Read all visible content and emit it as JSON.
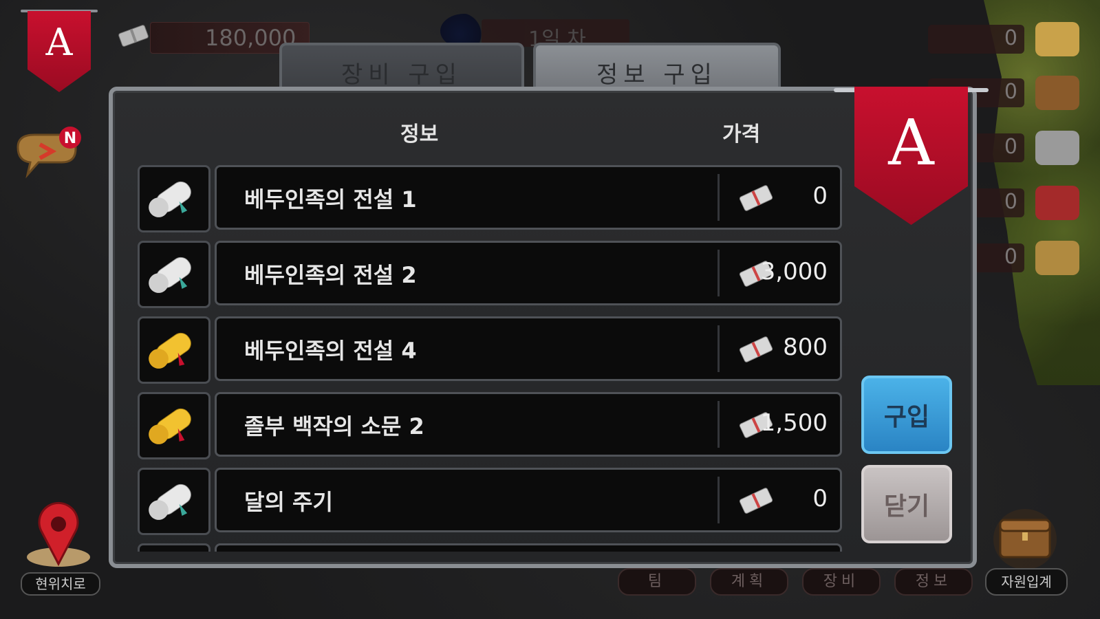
{
  "hud": {
    "money": "180,000",
    "day": "1일 차",
    "resources": [
      "0",
      "0",
      "0",
      "0",
      "0"
    ]
  },
  "tabs": {
    "equipment": "장비 구입",
    "info": "정보 구입"
  },
  "headers": {
    "info": "정보",
    "price": "가격"
  },
  "rows": [
    {
      "name": "베두인족의 전설 1",
      "price": "0",
      "scroll": "white"
    },
    {
      "name": "베두인족의 전설 2",
      "price": "3,000",
      "scroll": "white"
    },
    {
      "name": "베두인족의 전설 4",
      "price": "800",
      "scroll": "gold"
    },
    {
      "name": "졸부 백작의 소문 2",
      "price": "1,500",
      "scroll": "gold"
    },
    {
      "name": "달의 주기",
      "price": "0",
      "scroll": "white"
    }
  ],
  "buttons": {
    "buy": "구입",
    "close": "닫기"
  },
  "emblem": "A",
  "notification_badge": "N",
  "bottom_nav": {
    "location": "현위치로",
    "team": "팀",
    "plan": "계획",
    "equip": "장비",
    "info": "정보",
    "resources": "자원입계"
  },
  "colors": {
    "banner": "#c8102e",
    "buy": "#3a9bd8",
    "close": "#b8b1b1"
  }
}
